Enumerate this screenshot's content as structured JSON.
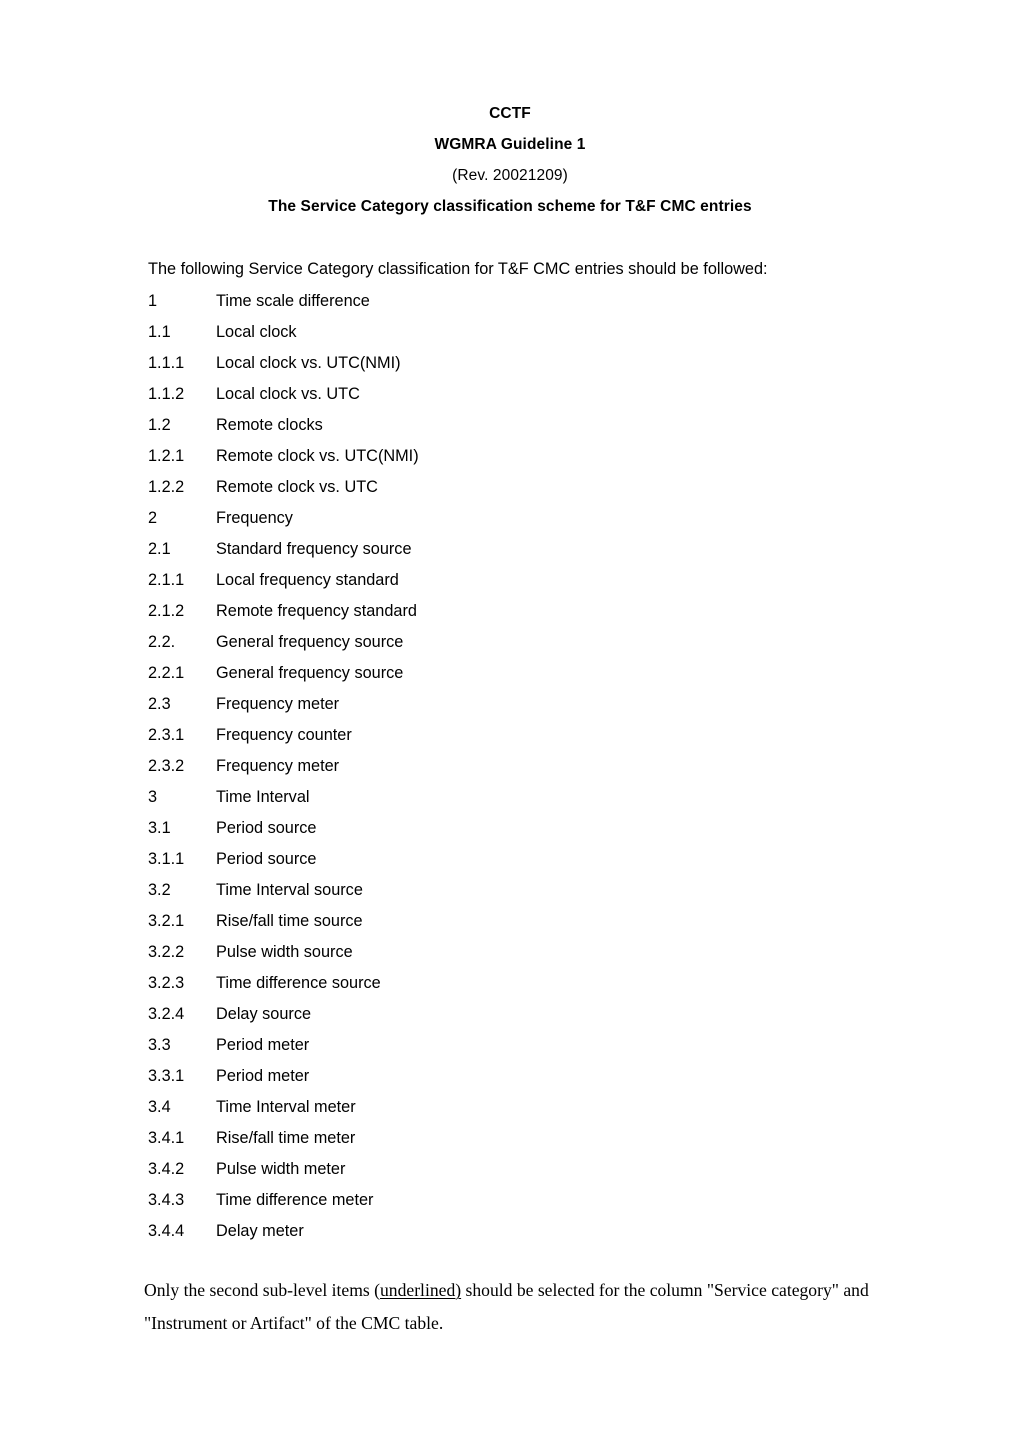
{
  "document": {
    "header": {
      "line1": "CCTF",
      "line2": "WGMRA Guideline 1",
      "line3": "(Rev. 20021209)",
      "line4": "The Service Category classification scheme for T&F CMC entries"
    },
    "intro": "The following Service Category classification for T&F CMC entries should be followed:",
    "outline": [
      {
        "number": "1",
        "label": "Time scale difference",
        "level": 1
      },
      {
        "number": "1.1",
        "label": "Local clock",
        "level": 2
      },
      {
        "number": "1.1.1",
        "label": "Local clock vs. UTC(NMI)",
        "level": 3
      },
      {
        "number": "1.1.2",
        "label": "Local clock vs. UTC",
        "level": 3
      },
      {
        "number": "1.2",
        "label": "Remote clocks",
        "level": 2
      },
      {
        "number": "1.2.1",
        "label": "Remote clock vs. UTC(NMI)",
        "level": 3
      },
      {
        "number": "1.2.2",
        "label": "Remote clock vs. UTC",
        "level": 3
      },
      {
        "number": "2",
        "label": "Frequency",
        "level": 1
      },
      {
        "number": "2.1",
        "label": "Standard frequency source",
        "level": 2
      },
      {
        "number": "2.1.1",
        "label": "Local frequency standard",
        "level": 3
      },
      {
        "number": "2.1.2",
        "label": "Remote frequency standard",
        "level": 3
      },
      {
        "number": "2.2.",
        "label": "General frequency source",
        "level": 2
      },
      {
        "number": "2.2.1",
        "label": "General frequency source",
        "level": 3
      },
      {
        "number": "2.3",
        "label": "Frequency meter",
        "level": 2
      },
      {
        "number": "2.3.1",
        "label": "Frequency counter",
        "level": 3
      },
      {
        "number": "2.3.2",
        "label": "Frequency meter",
        "level": 3
      },
      {
        "number": "3",
        "label": "Time Interval",
        "level": 1
      },
      {
        "number": "3.1",
        "label": "Period source",
        "level": 2
      },
      {
        "number": "3.1.1",
        "label": "Period source",
        "level": 3
      },
      {
        "number": "3.2",
        "label": "Time Interval source",
        "level": 2
      },
      {
        "number": "3.2.1",
        "label": "Rise/fall time source",
        "level": 3
      },
      {
        "number": "3.2.2",
        "label": "Pulse width source",
        "level": 3
      },
      {
        "number": "3.2.3",
        "label": "Time difference source",
        "level": 3
      },
      {
        "number": "3.2.4",
        "label": "Delay source",
        "level": 3
      },
      {
        "number": "3.3",
        "label": "Period meter",
        "level": 2
      },
      {
        "number": "3.3.1",
        "label": "Period meter",
        "level": 3
      },
      {
        "number": "3.4",
        "label": "Time Interval meter",
        "level": 2
      },
      {
        "number": "3.4.1",
        "label": "Rise/fall time meter",
        "level": 3
      },
      {
        "number": "3.4.2",
        "label": "Pulse width meter",
        "level": 3
      },
      {
        "number": "3.4.3",
        "label": "Time difference meter",
        "level": 3
      },
      {
        "number": "3.4.4",
        "label": "Delay meter",
        "level": 3
      }
    ],
    "closing": {
      "part1": "Only the second sub-level items (",
      "underlined": "underlined)",
      "part2": " should be selected for the column \"Service category\" and \"Instrument or Artifact\" of the CMC table."
    }
  }
}
